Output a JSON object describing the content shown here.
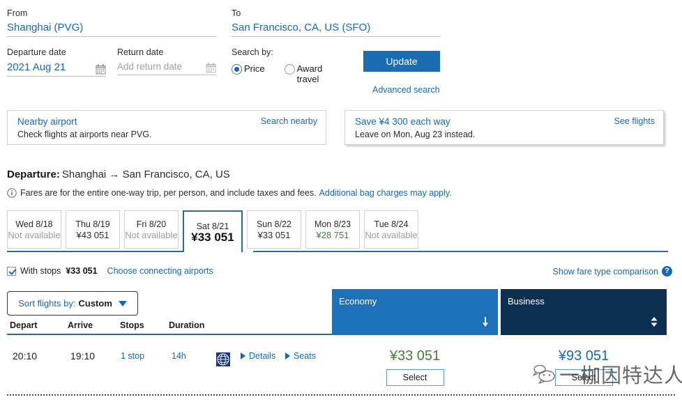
{
  "search": {
    "from": {
      "label": "From",
      "value": "Shanghai (PVG)"
    },
    "to": {
      "label": "To",
      "value": "San Francisco, CA, US (SFO)"
    },
    "departure_date": {
      "label": "Departure date",
      "value": "2021 Aug 21"
    },
    "return_date": {
      "label": "Return date",
      "placeholder": "Add return date",
      "value": ""
    },
    "search_by": {
      "label": "Search by:",
      "options": [
        "Price",
        "Award travel"
      ],
      "selected": "Price"
    },
    "update_button": "Update",
    "advanced_search": "Advanced search"
  },
  "banners": [
    {
      "title": "Nearby airport",
      "subtitle": "Check flights at airports near PVG.",
      "link": "Search nearby"
    },
    {
      "title": "Save ¥4 300 each way",
      "subtitle": "Leave on Mon, Aug 23 instead.",
      "link": "See flights"
    }
  ],
  "departure": {
    "heading_label": "Departure:",
    "route": "Shanghai → San Francisco, CA, US",
    "fare_note": "Fares are for the entire one-way trip, per person, and include taxes and fees.",
    "fare_note_link": "Additional bag charges may apply."
  },
  "date_tabs": [
    {
      "day": "Wed 8/18",
      "price": "Not available",
      "state": "unavailable"
    },
    {
      "day": "Thu 8/19",
      "price": "¥43 051",
      "state": "available"
    },
    {
      "day": "Fri 8/20",
      "price": "Not available",
      "state": "unavailable"
    },
    {
      "day": "Sat 8/21",
      "price": "¥33 051",
      "state": "selected"
    },
    {
      "day": "Sun 8/22",
      "price": "¥33 051",
      "state": "available"
    },
    {
      "day": "Mon 8/23",
      "price": "¥28 751",
      "state": "lowest"
    },
    {
      "day": "Tue 8/24",
      "price": "Not available",
      "state": "unavailable"
    }
  ],
  "stops_filter": {
    "checkbox_label": "With stops",
    "checked": true,
    "price": "¥33 051",
    "link": "Choose connecting airports"
  },
  "fare_comparison": {
    "link": "Show fare type comparison",
    "help_glyph": "?"
  },
  "sort": {
    "label": "Sort flights by:",
    "value": "Custom"
  },
  "columns": {
    "depart": "Depart",
    "arrive": "Arrive",
    "stops": "Stops",
    "duration": "Duration"
  },
  "cabins": [
    {
      "name": "Economy",
      "color": "#1d71b8",
      "sort_state": "descending"
    },
    {
      "name": "Business",
      "color": "#0c2f52",
      "sort_state": "unsorted"
    }
  ],
  "flights": [
    {
      "depart": "20:10",
      "arrive": "19:10",
      "stops": "1 stop",
      "duration": "14h",
      "details_link": "Details",
      "seats_link": "Seats",
      "economy": {
        "price": "¥33 051",
        "color": "#4b7a39",
        "button": "Select"
      },
      "business": {
        "price": "¥93 051",
        "color": "#1668b3",
        "button": "Select"
      }
    }
  ],
  "watermark": {
    "text": "一枷因特达人"
  }
}
